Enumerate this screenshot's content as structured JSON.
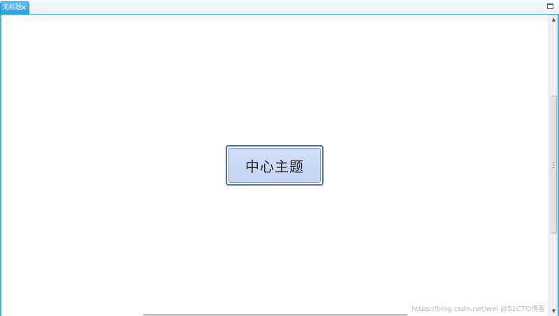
{
  "tabs": [
    {
      "label": "无标题",
      "active": true,
      "close_glyph": "×"
    }
  ],
  "window_controls": {
    "maximize_icon": "maximize-icon"
  },
  "canvas": {
    "central_topic": {
      "label": "中心主题"
    }
  },
  "scrollbar": {
    "up_arrow": "▲",
    "down_arrow": "▼"
  },
  "watermark": "https://blog.csdn.net/wei  @51CTO博客",
  "colors": {
    "tab_active": "#3aa7e4",
    "frame_border": "#48a9e0",
    "topic_border": "#4f6fae",
    "topic_fill": "#c9dbf8"
  }
}
